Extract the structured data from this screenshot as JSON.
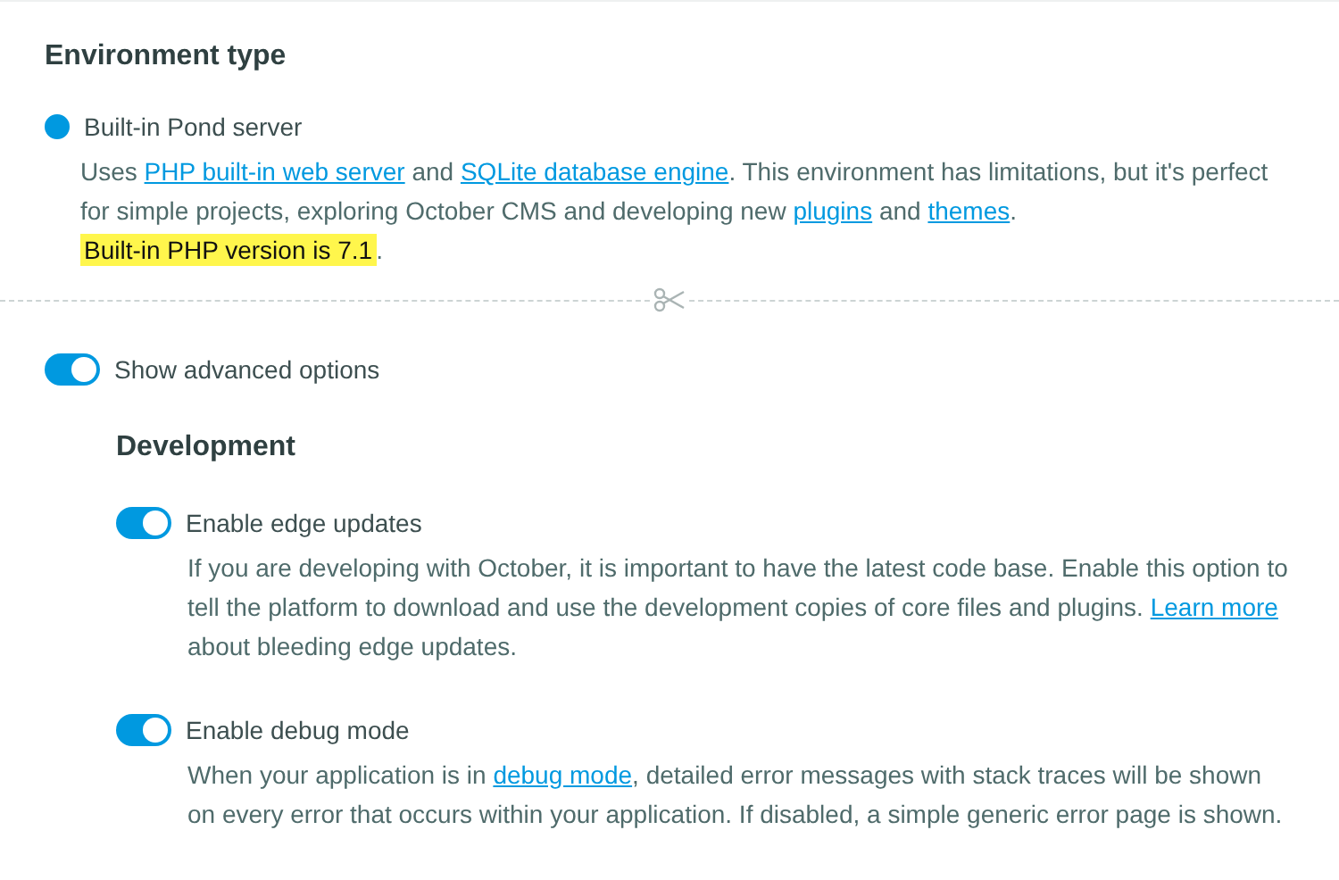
{
  "environment": {
    "title": "Environment type",
    "option": {
      "label": "Built-in Pond server",
      "selected": true,
      "description": [
        {
          "kind": "text",
          "text": "Uses "
        },
        {
          "kind": "link",
          "text": "PHP built-in web server"
        },
        {
          "kind": "text",
          "text": " and "
        },
        {
          "kind": "link",
          "text": "SQLite database engine"
        },
        {
          "kind": "text",
          "text": ". This environment has limitations, but it's perfect for simple projects, exploring October CMS and developing new "
        },
        {
          "kind": "link",
          "text": "plugins"
        },
        {
          "kind": "text",
          "text": " and "
        },
        {
          "kind": "link",
          "text": "themes"
        },
        {
          "kind": "text",
          "text": "."
        }
      ],
      "note": {
        "highlight": "Built-in PHP version is 7.1",
        "after": "."
      }
    }
  },
  "advanced": {
    "label": "Show advanced options",
    "on": true
  },
  "development": {
    "title": "Development",
    "options": [
      {
        "label": "Enable edge updates",
        "on": true,
        "description": [
          {
            "kind": "text",
            "text": "If you are developing with October, it is important to have the latest code base. Enable this option to tell the platform to download and use the development copies of core files and plugins. "
          },
          {
            "kind": "link",
            "text": "Learn more"
          },
          {
            "kind": "text",
            "text": " about bleeding edge updates."
          }
        ]
      },
      {
        "label": "Enable debug mode",
        "on": true,
        "description": [
          {
            "kind": "text",
            "text": "When your application is in "
          },
          {
            "kind": "link",
            "text": "debug mode"
          },
          {
            "kind": "text",
            "text": ", detailed error messages with stack traces will be shown on every error that occurs within your application. If disabled, a simple generic error page is shown."
          }
        ]
      }
    ]
  }
}
